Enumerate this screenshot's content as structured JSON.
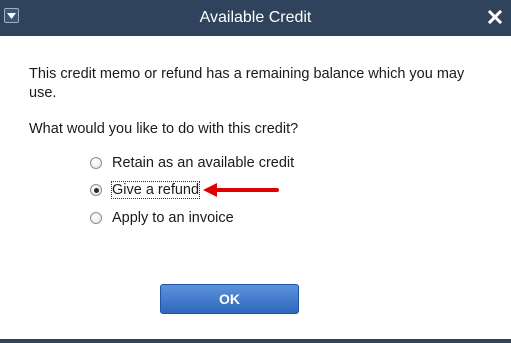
{
  "window": {
    "title": "Available Credit",
    "menu_icon": "window-menu-icon",
    "close_icon": "close-icon"
  },
  "message": {
    "line1": "This credit memo or refund has a remaining balance which you may use.",
    "question": "What would you like to do with this credit?"
  },
  "options": [
    {
      "label": "Retain as an available credit",
      "selected": false
    },
    {
      "label": "Give a refund",
      "selected": true
    },
    {
      "label": "Apply to an invoice",
      "selected": false
    }
  ],
  "buttons": {
    "ok_label": "OK"
  },
  "annotation": {
    "arrow_color": "#e00000",
    "arrow_icon": "red-arrow-icon"
  },
  "colors": {
    "titlebar": "#2f435c",
    "ok_button": "#3f78cc"
  }
}
